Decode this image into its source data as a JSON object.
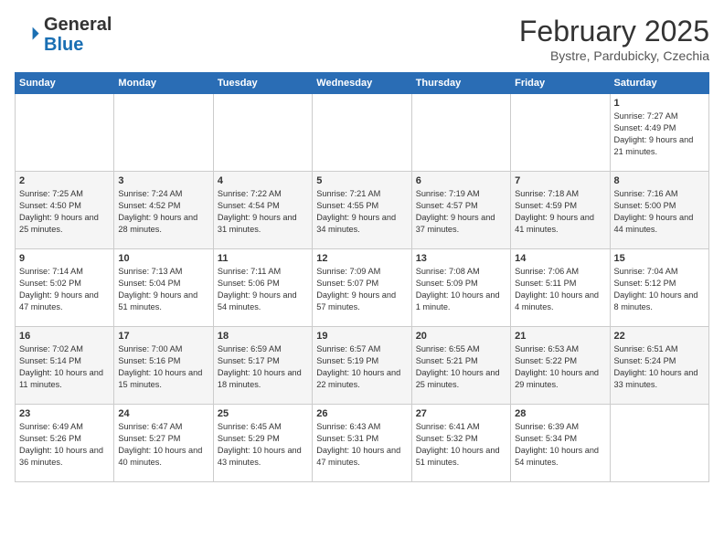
{
  "header": {
    "logo_general": "General",
    "logo_blue": "Blue",
    "title": "February 2025",
    "subtitle": "Bystre, Pardubicky, Czechia"
  },
  "days_of_week": [
    "Sunday",
    "Monday",
    "Tuesday",
    "Wednesday",
    "Thursday",
    "Friday",
    "Saturday"
  ],
  "weeks": [
    [
      {
        "day": "",
        "info": ""
      },
      {
        "day": "",
        "info": ""
      },
      {
        "day": "",
        "info": ""
      },
      {
        "day": "",
        "info": ""
      },
      {
        "day": "",
        "info": ""
      },
      {
        "day": "",
        "info": ""
      },
      {
        "day": "1",
        "info": "Sunrise: 7:27 AM\nSunset: 4:49 PM\nDaylight: 9 hours and 21 minutes."
      }
    ],
    [
      {
        "day": "2",
        "info": "Sunrise: 7:25 AM\nSunset: 4:50 PM\nDaylight: 9 hours and 25 minutes."
      },
      {
        "day": "3",
        "info": "Sunrise: 7:24 AM\nSunset: 4:52 PM\nDaylight: 9 hours and 28 minutes."
      },
      {
        "day": "4",
        "info": "Sunrise: 7:22 AM\nSunset: 4:54 PM\nDaylight: 9 hours and 31 minutes."
      },
      {
        "day": "5",
        "info": "Sunrise: 7:21 AM\nSunset: 4:55 PM\nDaylight: 9 hours and 34 minutes."
      },
      {
        "day": "6",
        "info": "Sunrise: 7:19 AM\nSunset: 4:57 PM\nDaylight: 9 hours and 37 minutes."
      },
      {
        "day": "7",
        "info": "Sunrise: 7:18 AM\nSunset: 4:59 PM\nDaylight: 9 hours and 41 minutes."
      },
      {
        "day": "8",
        "info": "Sunrise: 7:16 AM\nSunset: 5:00 PM\nDaylight: 9 hours and 44 minutes."
      }
    ],
    [
      {
        "day": "9",
        "info": "Sunrise: 7:14 AM\nSunset: 5:02 PM\nDaylight: 9 hours and 47 minutes."
      },
      {
        "day": "10",
        "info": "Sunrise: 7:13 AM\nSunset: 5:04 PM\nDaylight: 9 hours and 51 minutes."
      },
      {
        "day": "11",
        "info": "Sunrise: 7:11 AM\nSunset: 5:06 PM\nDaylight: 9 hours and 54 minutes."
      },
      {
        "day": "12",
        "info": "Sunrise: 7:09 AM\nSunset: 5:07 PM\nDaylight: 9 hours and 57 minutes."
      },
      {
        "day": "13",
        "info": "Sunrise: 7:08 AM\nSunset: 5:09 PM\nDaylight: 10 hours and 1 minute."
      },
      {
        "day": "14",
        "info": "Sunrise: 7:06 AM\nSunset: 5:11 PM\nDaylight: 10 hours and 4 minutes."
      },
      {
        "day": "15",
        "info": "Sunrise: 7:04 AM\nSunset: 5:12 PM\nDaylight: 10 hours and 8 minutes."
      }
    ],
    [
      {
        "day": "16",
        "info": "Sunrise: 7:02 AM\nSunset: 5:14 PM\nDaylight: 10 hours and 11 minutes."
      },
      {
        "day": "17",
        "info": "Sunrise: 7:00 AM\nSunset: 5:16 PM\nDaylight: 10 hours and 15 minutes."
      },
      {
        "day": "18",
        "info": "Sunrise: 6:59 AM\nSunset: 5:17 PM\nDaylight: 10 hours and 18 minutes."
      },
      {
        "day": "19",
        "info": "Sunrise: 6:57 AM\nSunset: 5:19 PM\nDaylight: 10 hours and 22 minutes."
      },
      {
        "day": "20",
        "info": "Sunrise: 6:55 AM\nSunset: 5:21 PM\nDaylight: 10 hours and 25 minutes."
      },
      {
        "day": "21",
        "info": "Sunrise: 6:53 AM\nSunset: 5:22 PM\nDaylight: 10 hours and 29 minutes."
      },
      {
        "day": "22",
        "info": "Sunrise: 6:51 AM\nSunset: 5:24 PM\nDaylight: 10 hours and 33 minutes."
      }
    ],
    [
      {
        "day": "23",
        "info": "Sunrise: 6:49 AM\nSunset: 5:26 PM\nDaylight: 10 hours and 36 minutes."
      },
      {
        "day": "24",
        "info": "Sunrise: 6:47 AM\nSunset: 5:27 PM\nDaylight: 10 hours and 40 minutes."
      },
      {
        "day": "25",
        "info": "Sunrise: 6:45 AM\nSunset: 5:29 PM\nDaylight: 10 hours and 43 minutes."
      },
      {
        "day": "26",
        "info": "Sunrise: 6:43 AM\nSunset: 5:31 PM\nDaylight: 10 hours and 47 minutes."
      },
      {
        "day": "27",
        "info": "Sunrise: 6:41 AM\nSunset: 5:32 PM\nDaylight: 10 hours and 51 minutes."
      },
      {
        "day": "28",
        "info": "Sunrise: 6:39 AM\nSunset: 5:34 PM\nDaylight: 10 hours and 54 minutes."
      },
      {
        "day": "",
        "info": ""
      }
    ]
  ]
}
